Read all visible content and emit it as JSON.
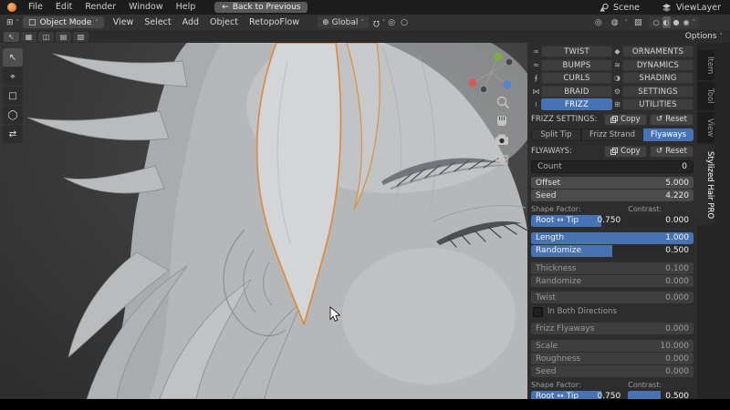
{
  "topbar": {
    "menus": [
      "File",
      "Edit",
      "Render",
      "Window",
      "Help"
    ],
    "back_button": "Back to Previous",
    "scene_label": "Scene",
    "viewlayer_label": "ViewLayer"
  },
  "viewport_header": {
    "mode_selector": "Object Mode",
    "menus": [
      "View",
      "Select",
      "Add",
      "Object",
      "RetopoFlow"
    ],
    "orientation": "Global",
    "options_label": "Options"
  },
  "sidebar_tabs": [
    "Item",
    "Tool",
    "View",
    "Stylized Hair PRO"
  ],
  "panel": {
    "categories_left": [
      "TWIST",
      "BUMPS",
      "CURLS",
      "BRAID",
      "FRIZZ"
    ],
    "categories_right": [
      "ORNAMENTS",
      "DYNAMICS",
      "SHADING",
      "SETTINGS",
      "UTILITIES"
    ],
    "frizz_settings_label": "FRIZZ SETTINGS:",
    "flyaways_label": "FLYAWAYS:",
    "copy_label": "Copy",
    "reset_label": "Reset",
    "sub_tabs": [
      "Split Tip",
      "Frizz Strand",
      "Flyaways"
    ],
    "count": {
      "label": "Count",
      "value": "0"
    },
    "offset": {
      "label": "Offset",
      "value": "5.000"
    },
    "seed": {
      "label": "Seed",
      "value": "4.220"
    },
    "shape_factor_label": "Shape Factor:",
    "contrast_label": "Contrast:",
    "root_tip": {
      "label": "Root ↔ Tip",
      "value": "0.750"
    },
    "contrast": {
      "value": "0.000"
    },
    "length": {
      "label": "Length",
      "value": "1.000"
    },
    "randomize": {
      "label": "Randomize",
      "value": "0.500"
    },
    "thickness": {
      "label": "Thickness",
      "value": "0.100"
    },
    "randomize2": {
      "label": "Randomize",
      "value": "0.000"
    },
    "twist": {
      "label": "Twist",
      "value": "0.000"
    },
    "in_both_directions_label": "In Both Directions",
    "frizz_flyaways": {
      "label": "Frizz Flyaways",
      "value": "0.000"
    },
    "scale": {
      "label": "Scale",
      "value": "10.000"
    },
    "roughness": {
      "label": "Roughness",
      "value": "0.000"
    },
    "seed2": {
      "label": "Seed",
      "value": "0.000"
    },
    "shape_factor2_label": "Shape Factor:",
    "contrast2_label": "Contrast:",
    "root_tip2": {
      "label": "Root ↔ Tip",
      "value": "0.750"
    },
    "contrast2": {
      "value": "0.500"
    }
  },
  "icons": {
    "twist": "∞",
    "bumps": "≈",
    "curls": "∮",
    "braid": "⋈",
    "frizz": "≀",
    "ornaments": "◆",
    "dynamics": "≋",
    "shading": "◑",
    "settings": "⚙",
    "utilities": "⊞",
    "reset": "↺",
    "back": "←",
    "caret": "˅",
    "editor": "⊞",
    "cube": "□",
    "globe": "⊕",
    "magnet": "Ω",
    "pivot": "◎",
    "proportional": "○",
    "overlays": "◍",
    "xray": "▨",
    "shade_wire": "○",
    "shade_solid": "◐",
    "shade_material": "●",
    "shade_render": "◉",
    "tool_select": "↖",
    "tool_cursor": "⌖",
    "tool_box": "□",
    "tool_circle": "◯",
    "tool_transform": "⇄",
    "mode_icons": [
      "▦",
      "◫",
      "▤",
      "▧"
    ]
  },
  "colors": {
    "accent": "#4772b3",
    "selection": "#e0883a"
  }
}
